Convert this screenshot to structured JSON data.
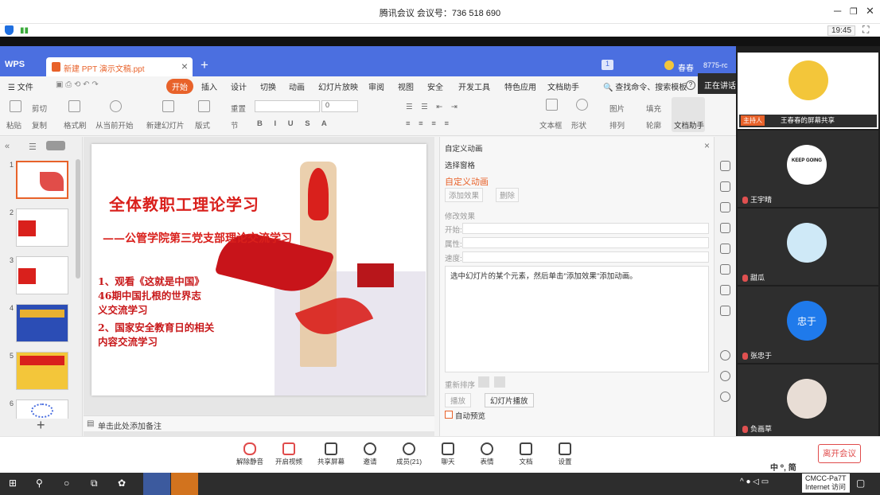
{
  "meeting": {
    "title": "腾讯会议 会议号：736 518 690",
    "time": "19:45",
    "speaking": "正在讲话: 黄凯;"
  },
  "wps": {
    "logo": "WPS",
    "doc_tab": "新建 PPT 演示文稿.ppt",
    "user": "春春",
    "user_status": "8775-rc",
    "menu": [
      "文件",
      "开始",
      "插入",
      "设计",
      "切换",
      "动画",
      "幻灯片放映",
      "审阅",
      "视图",
      "安全",
      "开发工具",
      "特色应用",
      "文档助手"
    ],
    "search": "查找命令、搜索模板",
    "ribbon": {
      "paste": "粘贴",
      "cut": "剪切",
      "copy": "复制",
      "format_painter": "格式刷",
      "play_from_current": "从当前开始",
      "new_slide": "新建幻灯片",
      "layout": "版式",
      "reset": "重置",
      "section": "节",
      "font_size": "0",
      "textbox": "文本框",
      "shape": "形状",
      "arrange": "排列",
      "picture": "图片",
      "fill": "填充",
      "outline": "轮廓",
      "doc_assistant": "文档助手"
    },
    "notes_placeholder": "单击此处添加备注"
  },
  "slide": {
    "title": "全体教职工理论学习",
    "subtitle": "——公管学院第三党支部理论交流学习",
    "item1_lines": [
      "1、观看《这就是中国》",
      "46期中国扎根的世界志",
      "义交流学习"
    ],
    "item2_lines": [
      "2、国家安全教育日的相关",
      "内容交流学习"
    ]
  },
  "thumbnails": [
    "1",
    "2",
    "3",
    "4",
    "5",
    "6"
  ],
  "anim_pane": {
    "header": "自定义动画",
    "select_pane": "选择窗格",
    "title": "自定义动画",
    "add_effect": "添加效果",
    "delete": "删除",
    "modify": "修改效果",
    "start_label": "开始:",
    "property_label": "属性:",
    "speed_label": "速度:",
    "hint": "选中幻灯片的某个元素，然后单击\"添加效果\"添加动画。",
    "reorder": "重新排序",
    "play": "播放",
    "slideshow": "幻灯片播放",
    "auto_preview": "自动预览"
  },
  "participants": [
    {
      "name": "王春春的屏幕共享",
      "role": "主持人"
    },
    {
      "name": "王宇晴",
      "avatar_text": "KEEP GOING"
    },
    {
      "name": "甜瓜"
    },
    {
      "name": "张忠于",
      "avatar_text": "忠于"
    },
    {
      "name": "负画草"
    }
  ],
  "toolbar": {
    "mute": "解除静音",
    "video": "开启视频",
    "share": "共享屏幕",
    "invite": "邀请",
    "members": "成员(21)",
    "chat": "聊天",
    "reaction": "表情",
    "docs": "文档",
    "settings": "设置",
    "leave": "离开会议",
    "ime": "中 ⁰, 简"
  },
  "taskbar": {
    "network_name": "CMCC-Pa7T",
    "network_status": "Internet 访问"
  },
  "colors": {
    "wps_blue": "#4b6fe0",
    "accent_orange": "#e8622a",
    "slide_red": "#d9201c",
    "leave_red": "#e04b4b"
  }
}
